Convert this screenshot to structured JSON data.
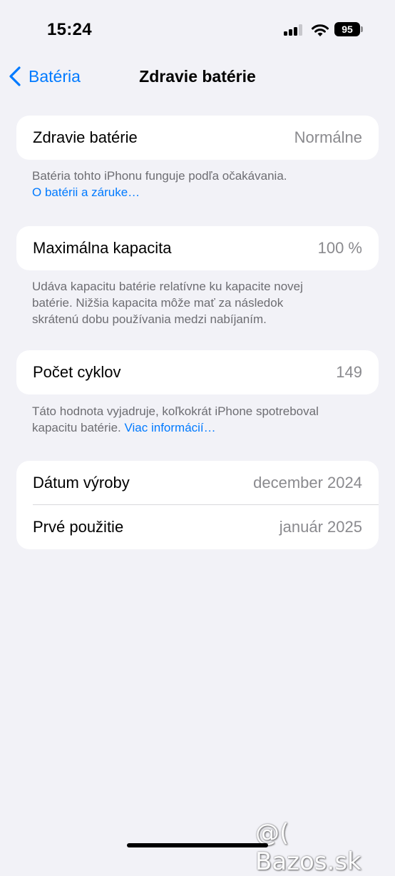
{
  "status_bar": {
    "time": "15:24",
    "battery_level": "95"
  },
  "nav": {
    "back_label": "Batéria",
    "title": "Zdravie batérie"
  },
  "sections": {
    "health": {
      "label": "Zdravie batérie",
      "value": "Normálne",
      "footer_text": "Batéria tohto iPhonu funguje podľa očakávania.",
      "footer_link": "O batérii a záruke…"
    },
    "capacity": {
      "label": "Maximálna kapacita",
      "value": "100 %",
      "footer_lines": [
        "Udáva kapacitu batérie relatívne ku kapacite novej",
        "batérie. Nižšia kapacita môže mať za následok",
        "skrátenú dobu používania medzi nabíjaním."
      ]
    },
    "cycles": {
      "label": "Počet cyklov",
      "value": "149",
      "footer_line1": "Táto hodnota vyjadruje, koľkokrát iPhone spotreboval",
      "footer_line2": "kapacitu batérie.",
      "footer_link": "Viac informácií…"
    },
    "dates": {
      "manufacture_label": "Dátum výroby",
      "manufacture_value": "december 2024",
      "first_use_label": "Prvé použitie",
      "first_use_value": "január 2025"
    }
  },
  "watermark": "@( Bazos.sk",
  "colors": {
    "accent": "#007aff",
    "background": "#f2f2f7",
    "card": "#ffffff",
    "secondary_text": "#8a8a8e"
  }
}
